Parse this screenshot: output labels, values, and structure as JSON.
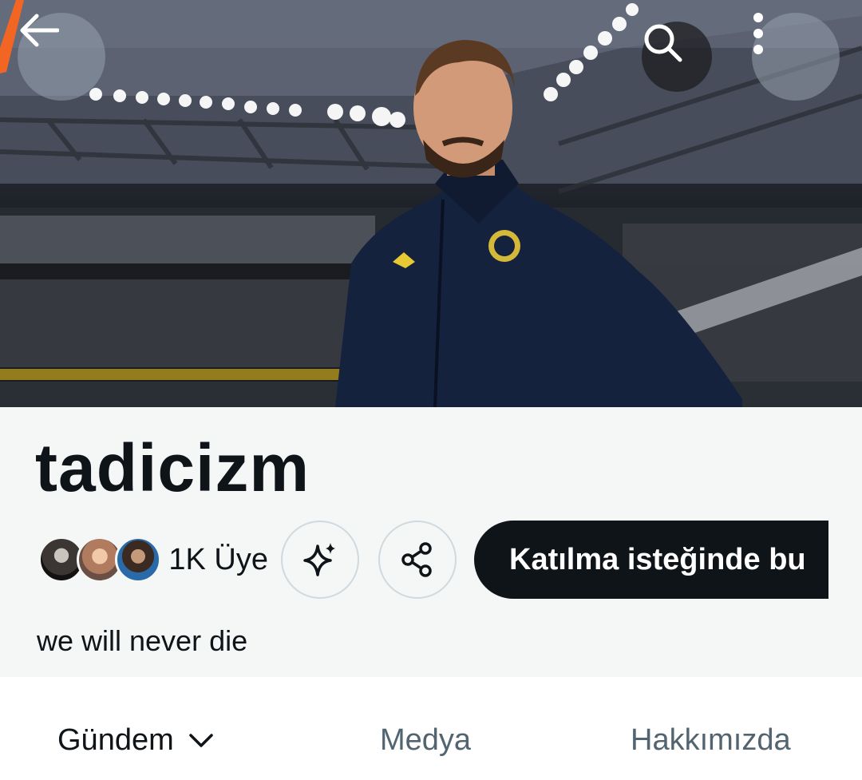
{
  "header": {
    "back_icon": "arrow-left-icon",
    "search_icon": "search-icon",
    "more_icon": "more-vertical-icon"
  },
  "community": {
    "name": "tadicizm",
    "member_count_label": "1K Üye",
    "description": "we will never die",
    "join_button_label": "Katılma isteğinde bu"
  },
  "actions": {
    "sparkle_icon": "sparkle-icon",
    "share_icon": "share-icon"
  },
  "tabs": [
    {
      "label": "Gündem",
      "active": true,
      "has_dropdown": true
    },
    {
      "label": "Medya",
      "active": false
    },
    {
      "label": "Hakkımızda",
      "active": false
    }
  ],
  "colors": {
    "text_primary": "#0f1419",
    "text_secondary": "#536471",
    "join_button_bg": "#0f1419",
    "info_bg": "#f5f6f6",
    "accent_mark": "#f26522"
  }
}
